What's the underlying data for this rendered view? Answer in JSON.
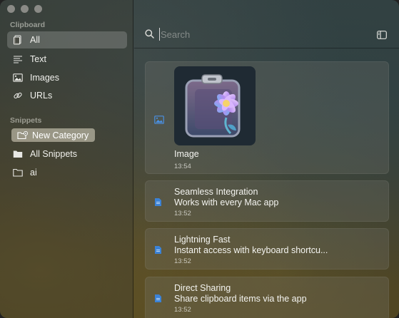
{
  "sidebar": {
    "clipboard_label": "Clipboard",
    "items": [
      {
        "label": "All",
        "icon": "document-icon",
        "active": true
      },
      {
        "label": "Text",
        "icon": "text-lines-icon",
        "active": false
      },
      {
        "label": "Images",
        "icon": "image-icon",
        "active": false
      },
      {
        "label": "URLs",
        "icon": "link-icon",
        "active": false
      }
    ],
    "snippets_label": "Snippets",
    "new_category_label": "New Category",
    "snippet_items": [
      {
        "label": "All Snippets",
        "icon": "folder-filled-icon"
      },
      {
        "label": "ai",
        "icon": "folder-outline-icon"
      }
    ]
  },
  "search": {
    "placeholder": "Search",
    "value": ""
  },
  "clips": [
    {
      "type": "image",
      "icon": "image-icon",
      "title": "Image",
      "time": "13:54"
    },
    {
      "type": "text",
      "icon": "document-icon",
      "title": "Seamless Integration",
      "subtitle": "Works with every Mac app",
      "time": "13:52"
    },
    {
      "type": "text",
      "icon": "document-icon",
      "title": "Lightning Fast",
      "subtitle": "Instant access with keyboard shortcu...",
      "time": "13:52"
    },
    {
      "type": "text",
      "icon": "document-icon",
      "title": "Direct Sharing",
      "subtitle": "Share clipboard items via the app",
      "time": "13:52"
    }
  ],
  "colors": {
    "accent": "#3b82d6",
    "sidebar_active": "rgba(255,255,255,0.18)"
  }
}
